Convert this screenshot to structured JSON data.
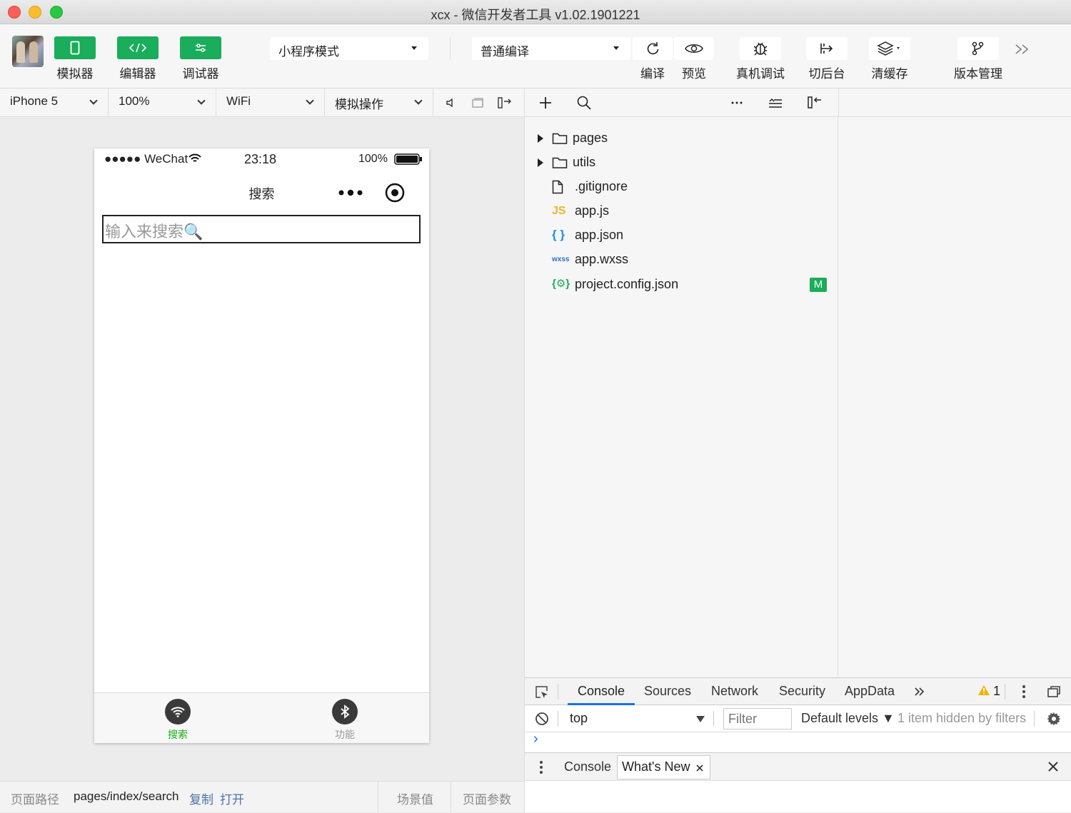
{
  "window": {
    "title": "xcx - 微信开发者工具 v1.02.1901221"
  },
  "toolbar": {
    "simulator_label": "模拟器",
    "editor_label": "编辑器",
    "debugger_label": "调试器",
    "mode_value": "小程序模式",
    "compile_mode_value": "普通编译",
    "compile_label": "编译",
    "preview_label": "预览",
    "remote_debug_label": "真机调试",
    "background_label": "切后台",
    "clear_cache_label": "清缓存",
    "version_label": "版本管理",
    "accent_color": "#1aad5b"
  },
  "simbar": {
    "device": "iPhone 5",
    "zoom": "100%",
    "network": "WiFi",
    "operation": "模拟操作"
  },
  "phone": {
    "carrier": "●●●●● WeChat",
    "time": "23:18",
    "battery": "100%",
    "nav_title": "搜索",
    "search_placeholder": "输入来搜索🔍",
    "tabs": [
      {
        "label": "搜索",
        "icon": "wifi-icon",
        "active": true
      },
      {
        "label": "功能",
        "icon": "bluetooth-icon",
        "active": false
      }
    ]
  },
  "files": [
    {
      "name": "pages",
      "type": "folder"
    },
    {
      "name": "utils",
      "type": "folder"
    },
    {
      "name": ".gitignore",
      "type": "file"
    },
    {
      "name": "app.js",
      "type": "js",
      "badge_text": "JS"
    },
    {
      "name": "app.json",
      "type": "json",
      "badge_text": "{ }"
    },
    {
      "name": "app.wxss",
      "type": "wxss",
      "badge_text": "wxss"
    },
    {
      "name": "project.config.json",
      "type": "config",
      "badge_text": "{⚙}",
      "status": "M"
    }
  ],
  "devtools": {
    "tabs": [
      "Console",
      "Sources",
      "Network",
      "Security",
      "AppData"
    ],
    "warning_count": "1",
    "context": "top",
    "filter_placeholder": "Filter",
    "levels": "Default levels ▼",
    "hidden_info": "1 item hidden by filters",
    "prompt": "›",
    "drawer_tabs": [
      "Console",
      "What's New"
    ]
  },
  "pathbar": {
    "label": "页面路径",
    "path": "pages/index/search",
    "copy": "复制",
    "open": "打开",
    "scene": "场景值",
    "params": "页面参数"
  }
}
